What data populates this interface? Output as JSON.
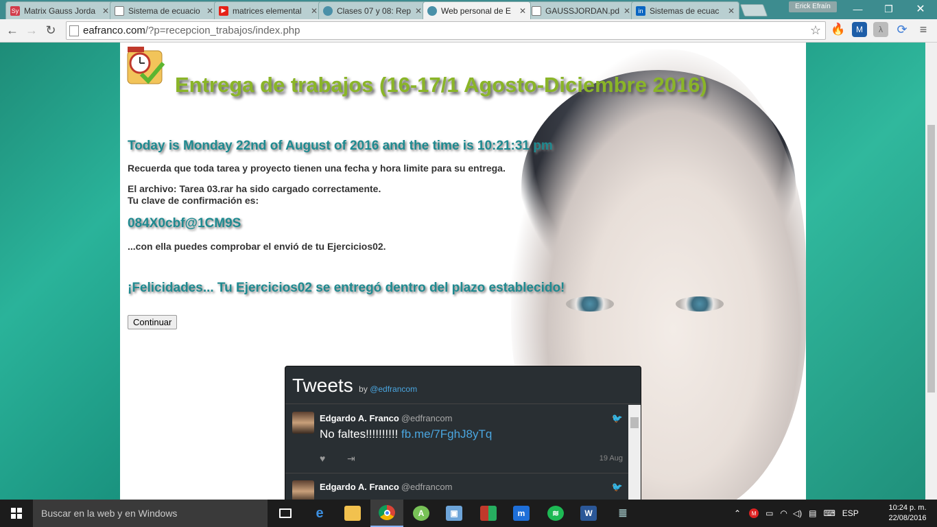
{
  "browser": {
    "tabs": [
      {
        "title": "Matrix Gauss Jorda",
        "icon": "symbolab-icon",
        "color": "#d23b4a",
        "glyph": "Sy"
      },
      {
        "title": "Sistema de ecuacio",
        "icon": "document-icon",
        "color": "#8a8a8a",
        "glyph": ""
      },
      {
        "title": "matrices elemental",
        "icon": "youtube-icon",
        "color": "#e62117",
        "glyph": "▶"
      },
      {
        "title": "Clases 07 y 08: Rep",
        "icon": "globe-icon",
        "color": "#4a90a8",
        "glyph": ""
      },
      {
        "title": "Web personal de E",
        "icon": "globe-icon",
        "color": "#4a90a8",
        "glyph": "",
        "active": true
      },
      {
        "title": "GAUSSJORDAN.pd",
        "icon": "document-icon",
        "color": "#8a8a8a",
        "glyph": ""
      },
      {
        "title": "Sistemas de ecuac",
        "icon": "linkedin-icon",
        "color": "#0a66c2",
        "glyph": "in"
      }
    ],
    "profile_name": "Erick Efraín",
    "url_host": "eafranco.com",
    "url_path": "/?p=recepcion_trabajos/index.php"
  },
  "page": {
    "title": "Entrega de trabajos (16-17/1 Agosto-Diciembre 2016)",
    "date_line": "Today is Monday 22nd of August of 2016 and the time is 10:21:31 pm",
    "reminder": "Recuerda que toda tarea y proyecto tienen una fecha y hora limite para su entrega.",
    "upload_msg": "El archivo: Tarea 03.rar ha sido cargado correctamente.",
    "key_label": "Tu clave de confirmación es:",
    "confirmation_code": "084X0cbf@1CM9S",
    "verify_msg": "...con ella puedes comprobar el envió de tu Ejercicios02.",
    "congrats": "¡Felicidades... Tu Ejercicios02 se entregó dentro del plazo establecido!",
    "continue_label": "Continuar"
  },
  "tweets": {
    "title": "Tweets",
    "by": "by",
    "by_handle": "@edfrancom",
    "items": [
      {
        "name": "Edgardo A. Franco",
        "handle": "@edfrancom",
        "text": "No faltes!!!!!!!!!! ",
        "link": "fb.me/7FghJ8yTq",
        "date": "19 Aug"
      },
      {
        "name": "Edgardo A. Franco",
        "handle": "@edfrancom",
        "text": "",
        "link": "",
        "date": ""
      }
    ]
  },
  "taskbar": {
    "search_placeholder": "Buscar en la web y en Windows",
    "language": "ESP",
    "time": "10:24 p. m.",
    "date": "22/08/2016"
  }
}
